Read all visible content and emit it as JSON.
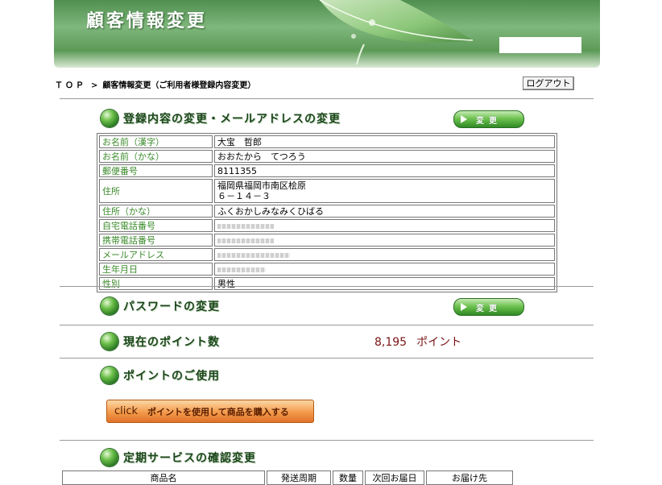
{
  "header": {
    "title": "顧客情報変更"
  },
  "breadcrumb": {
    "top": "ＴＯＰ",
    "separator": ">",
    "current": "顧客情報変更（ご利用者様登録内容変更）"
  },
  "logout_label": "ログアウト",
  "sections": {
    "registration": "登録内容の変更・メールアドレスの変更",
    "password": "パスワードの変更",
    "points": "現在のポイント数",
    "use_points": "ポイントのご使用",
    "subscription": "定期サービスの確認変更"
  },
  "change_button_label": "変更",
  "profile": {
    "rows": [
      {
        "label": "お名前（漢字）",
        "value": "大宝　哲郎"
      },
      {
        "label": "お名前（かな）",
        "value": "おおたから　てつろう"
      },
      {
        "label": "郵便番号",
        "value": "8111355"
      },
      {
        "label": "住所",
        "value": "福岡県福岡市南区桧原",
        "value2": "６－１４－３"
      },
      {
        "label": "住所（かな）",
        "value": "ふくおかしみなみくひばる"
      },
      {
        "label": "自宅電話番号",
        "value": ""
      },
      {
        "label": "携帯電話番号",
        "value": ""
      },
      {
        "label": "メールアドレス",
        "value": ""
      },
      {
        "label": "生年月日",
        "value": ""
      },
      {
        "label": "性別",
        "value": "男性"
      }
    ]
  },
  "points": {
    "value": "8,195",
    "unit": "ポイント"
  },
  "use_points_button": {
    "prefix": "click",
    "label": "ポイントを使用して商品を購入する"
  },
  "subscription_table": {
    "headers": [
      "商品名",
      "発送周期",
      "数量",
      "次回お届日",
      "お届け先"
    ]
  },
  "colors": {
    "section_text": "#1c461b",
    "table_label": "#3a8a2a",
    "points_text": "#7a1414",
    "click_button": "#f39a4a"
  }
}
